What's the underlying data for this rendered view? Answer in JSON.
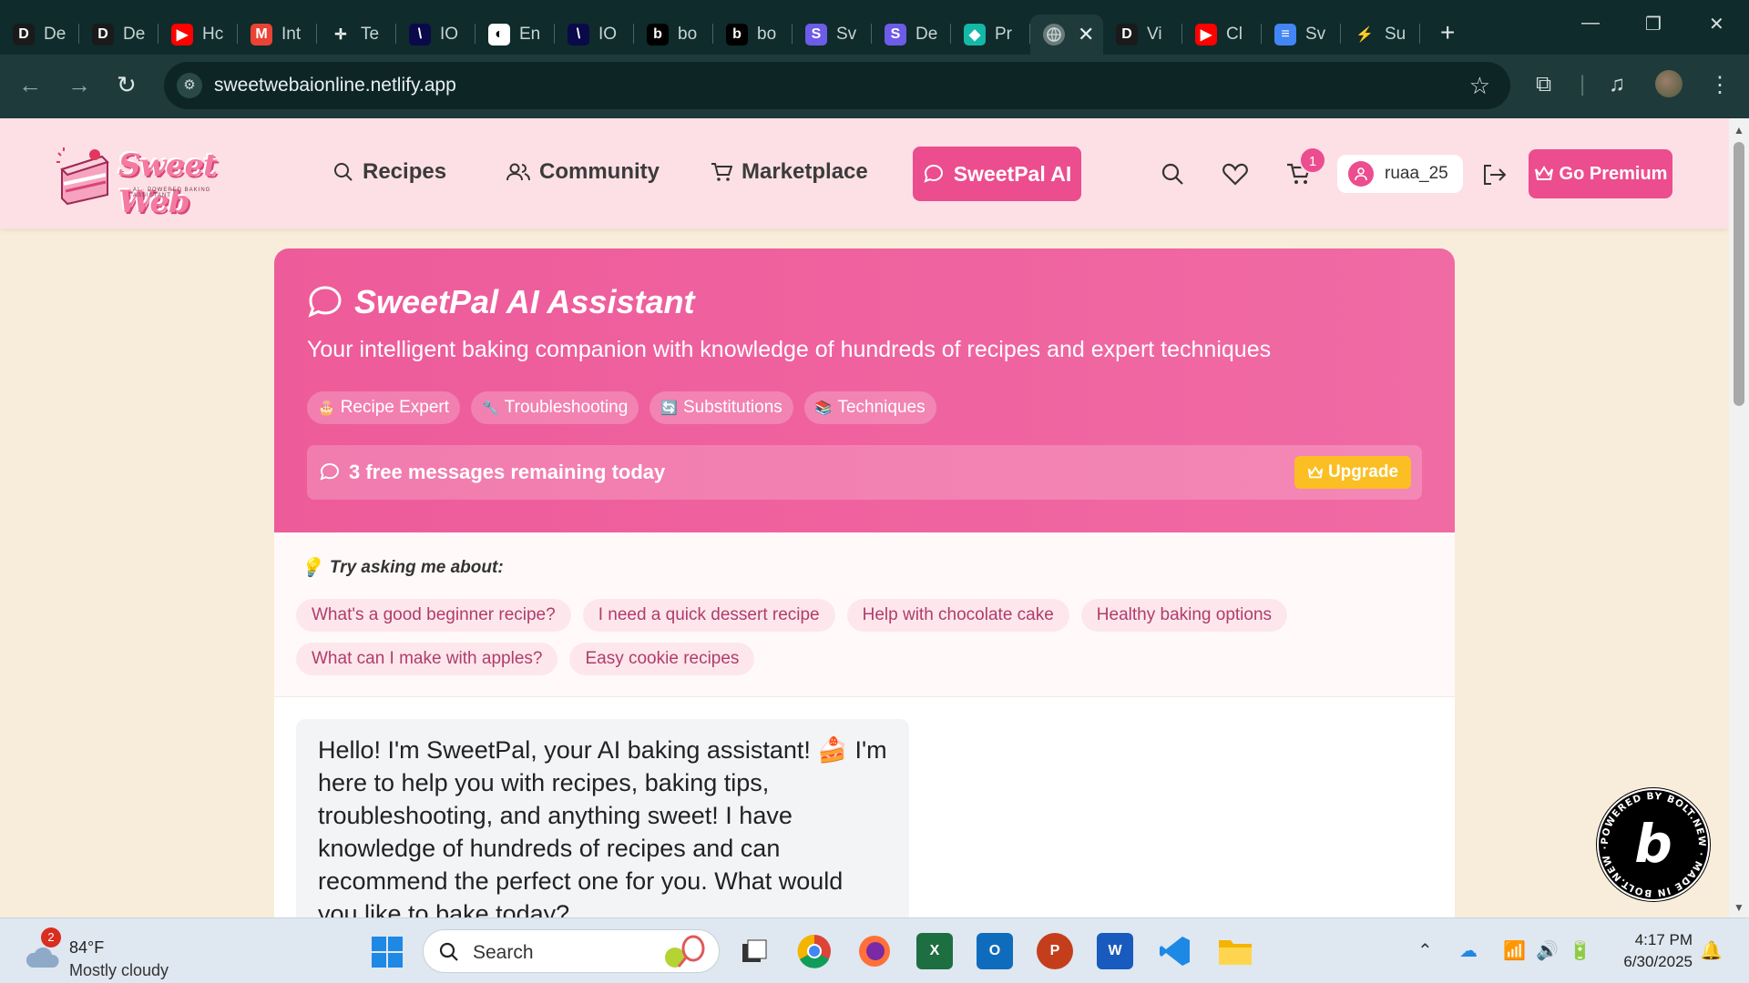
{
  "browser": {
    "tabs": [
      {
        "title": "De",
        "fav": "D",
        "color": "#1a1a1a",
        "icon": "d-icon"
      },
      {
        "title": "De",
        "fav": "D",
        "color": "#1a1a1a",
        "icon": "d-icon"
      },
      {
        "title": "Hc",
        "fav": "▶",
        "color": "#ff0000",
        "icon": "youtube-icon"
      },
      {
        "title": "Int",
        "fav": "M",
        "color": "#ea4335",
        "icon": "gmail-icon"
      },
      {
        "title": "Te",
        "fav": "✛",
        "color": "#0f2b2b",
        "icon": "teams-icon"
      },
      {
        "title": "IO",
        "fav": "\\",
        "color": "#0a0a4a",
        "icon": "io-icon"
      },
      {
        "title": "En",
        "fav": "◐",
        "color": "#ffffff",
        "icon": "openai-icon"
      },
      {
        "title": "IO",
        "fav": "\\",
        "color": "#0a0a4a",
        "icon": "io-icon"
      },
      {
        "title": "bo",
        "fav": "b",
        "color": "#000000",
        "icon": "bolt-icon"
      },
      {
        "title": "bo",
        "fav": "b",
        "color": "#000000",
        "icon": "bolt-icon"
      },
      {
        "title": "Sv",
        "fav": "S",
        "color": "#6c5ce7",
        "icon": "stack-icon"
      },
      {
        "title": "De",
        "fav": "S",
        "color": "#6c5ce7",
        "icon": "stack-icon"
      },
      {
        "title": "Pr",
        "fav": "◆",
        "color": "#14b8a6",
        "icon": "diamond-icon"
      }
    ],
    "active_tab": {
      "icon": "globe-icon"
    },
    "tabs_after": [
      {
        "title": "Vi",
        "fav": "D",
        "color": "#1a1a1a",
        "icon": "d-icon"
      },
      {
        "title": "Cl",
        "fav": "▶",
        "color": "#ff0000",
        "icon": "youtube-icon"
      },
      {
        "title": "Sv",
        "fav": "≡",
        "color": "#4285f4",
        "icon": "docs-icon"
      },
      {
        "title": "Su",
        "fav": "⚡",
        "color": "#0f2b2b",
        "icon": "supabase-icon"
      }
    ],
    "url": "sweetwebaionline.netlify.app"
  },
  "header": {
    "logo_text": "Sweet Web",
    "logo_sub": "AI · POWERED BAKING ASSISTANT",
    "nav": {
      "recipes": "Recipes",
      "community": "Community",
      "marketplace": "Marketplace",
      "ai": "SweetPal AI"
    },
    "cart_count": "1",
    "username": "ruaa_25",
    "premium": "Go Premium"
  },
  "hero": {
    "title": "SweetPal AI Assistant",
    "subtitle": "Your intelligent baking companion with knowledge of hundreds of recipes and expert techniques",
    "chips": [
      {
        "icon": "🎂",
        "label": "Recipe Expert"
      },
      {
        "icon": "🔧",
        "label": "Troubleshooting"
      },
      {
        "icon": "🔄",
        "label": "Substitutions"
      },
      {
        "icon": "📚",
        "label": "Techniques"
      }
    ],
    "free_messages": "3 free messages remaining today",
    "upgrade": "Upgrade"
  },
  "suggestions": {
    "title": "Try asking me about:",
    "items": [
      "What's a good beginner recipe?",
      "I need a quick dessert recipe",
      "Help with chocolate cake",
      "Healthy baking options",
      "What can I make with apples?",
      "Easy cookie recipes"
    ]
  },
  "chat": {
    "greeting": "Hello! I'm SweetPal, your AI baking assistant! 🍰 I'm here to help you with recipes, baking tips, troubleshooting, and anything sweet! I have knowledge of hundreds of recipes and can recommend the perfect one for you. What would you like to bake today?"
  },
  "bolt_badge": {
    "ring_text": "POWERED BY BOLT.NEW · MADE IN BOLT.NEW ·",
    "letter": "b"
  },
  "taskbar": {
    "weather_badge": "2",
    "temp": "84°F",
    "condition": "Mostly cloudy",
    "search": "Search",
    "time": "4:17 PM",
    "date": "6/30/2025"
  },
  "colors": {
    "brand_pink": "#ec4d8e",
    "hero_pink": "#ee5b9a",
    "upgrade_yellow": "#fbbf24",
    "header_bg": "#fde0e6",
    "page_bg": "#f8edda"
  }
}
